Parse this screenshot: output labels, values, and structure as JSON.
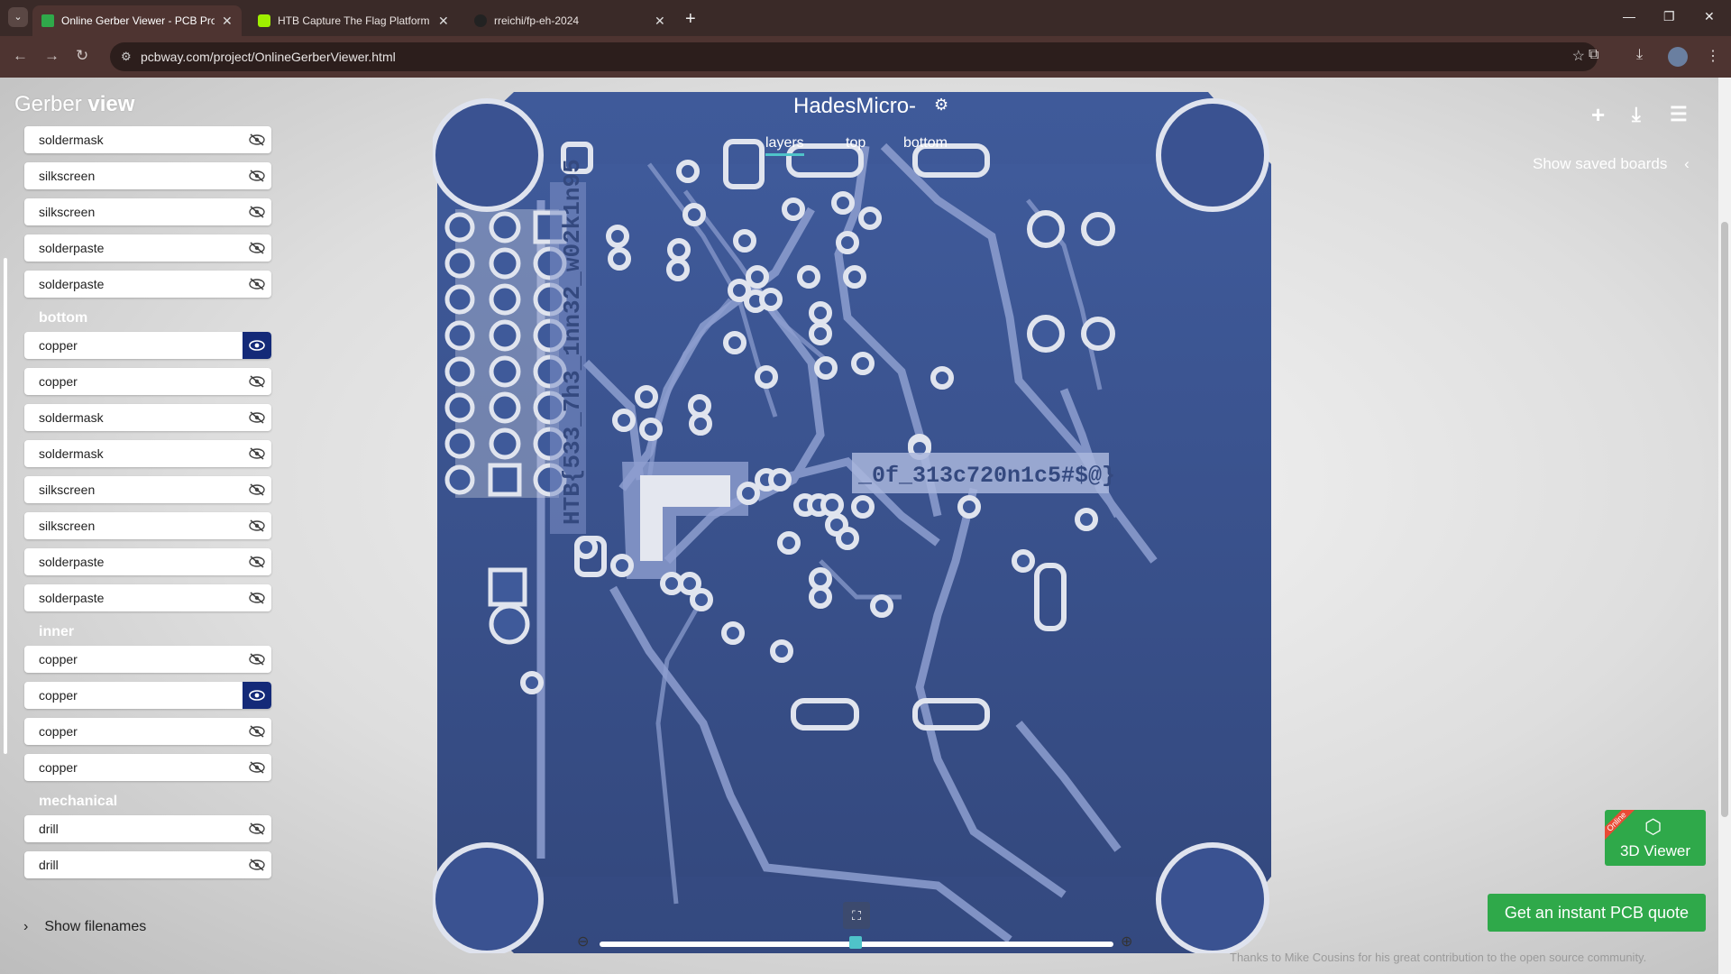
{
  "browser": {
    "tabs": [
      {
        "title": "Online Gerber Viewer - PCB Pro",
        "active": true,
        "favicon": "pcbway-icon"
      },
      {
        "title": "HTB Capture The Flag Platform",
        "active": false,
        "favicon": "htb-icon"
      },
      {
        "title": "rreichi/fp-eh-2024",
        "active": false,
        "favicon": "github-icon"
      }
    ],
    "url": "pcbway.com/project/OnlineGerberViewer.html"
  },
  "app": {
    "brand_light": "Gerber ",
    "brand_bold": "view",
    "board_title": "HadesMicro-",
    "view_tabs": [
      "layers",
      "top",
      "bottom"
    ],
    "show_saved_boards": "Show saved boards",
    "viewer3d_ribbon": "Online",
    "viewer3d_label": "3D Viewer",
    "quote_button": "Get an instant PCB quote",
    "credits": "Thanks to Mike Cousins for his great contribution to the open source community.",
    "show_filenames": "Show filenames",
    "silk_flag_left": "HTB{533_7h3_1nn32_w02k1n95",
    "silk_flag_right": "_0f_313c720n1c5#$@}",
    "zoom_level": 0.41
  },
  "layers": {
    "top_partial": [
      {
        "name": "soldermask",
        "visible": false
      },
      {
        "name": "silkscreen",
        "visible": false
      },
      {
        "name": "silkscreen",
        "visible": false
      },
      {
        "name": "solderpaste",
        "visible": false
      },
      {
        "name": "solderpaste",
        "visible": false
      }
    ],
    "bottom_title": "bottom",
    "bottom": [
      {
        "name": "copper",
        "visible": true
      },
      {
        "name": "copper",
        "visible": false
      },
      {
        "name": "soldermask",
        "visible": false
      },
      {
        "name": "soldermask",
        "visible": false
      },
      {
        "name": "silkscreen",
        "visible": false
      },
      {
        "name": "silkscreen",
        "visible": false
      },
      {
        "name": "solderpaste",
        "visible": false
      },
      {
        "name": "solderpaste",
        "visible": false
      }
    ],
    "inner_title": "inner",
    "inner": [
      {
        "name": "copper",
        "visible": false
      },
      {
        "name": "copper",
        "visible": true
      },
      {
        "name": "copper",
        "visible": false
      },
      {
        "name": "copper",
        "visible": false
      }
    ],
    "mechanical_title": "mechanical",
    "mechanical": [
      {
        "name": "drill",
        "visible": false
      },
      {
        "name": "drill",
        "visible": false
      }
    ]
  },
  "colors": {
    "board": "#3f5a9a",
    "trace": "#8e9fd0",
    "pad": "#e0e4ee",
    "accent": "#4fc3c9",
    "green": "#2fa94a",
    "eye_on": "#142a78"
  }
}
